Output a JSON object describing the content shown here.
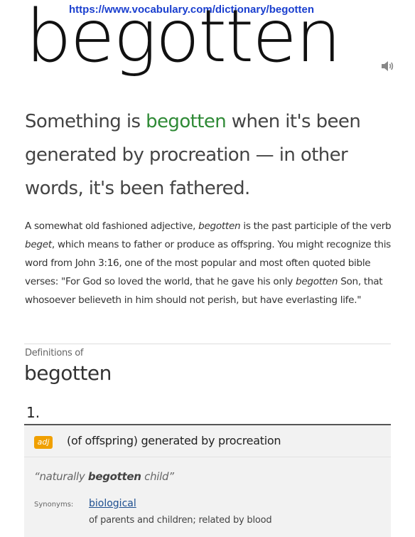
{
  "url": "https://www.vocabulary.com/dictionary/begotten",
  "headword": "begotten",
  "short_description": {
    "before": "Something is ",
    "highlight": "begotten",
    "after": " when it's been generated by procreation — in other words, it's been fathered."
  },
  "long_description": {
    "p1": "A somewhat old fashioned adjective, ",
    "i1": "begotten",
    "p2": " is the past participle of the verb ",
    "i2": "beget",
    "p3": ", which means to father or produce as offspring. You might recognize this word from John 3:16, one of the most popular and most often quoted bible verses: \"For God so loved the world, that he gave his only ",
    "i3": "begotten",
    "p4": " Son, that whosoever believeth in him should not perish, but have everlasting life.\""
  },
  "definitions": {
    "heading": "Definitions of",
    "word": "begotten",
    "senses": [
      {
        "number": "1.",
        "pos": "adj",
        "definition": "(of offspring) generated by procreation",
        "example_before": "“naturally ",
        "example_bold": "begotten",
        "example_after": " child”",
        "synonyms_label": "Synonyms:",
        "synonym": "biological",
        "synonym_gloss": "of parents and children; related by blood"
      }
    ]
  },
  "colors": {
    "highlight": "#2f8a36",
    "pos_badge": "#f0a000",
    "link": "#1d4e8f",
    "url": "#1a3fcf"
  },
  "icons": {
    "audio": "speaker-icon"
  }
}
